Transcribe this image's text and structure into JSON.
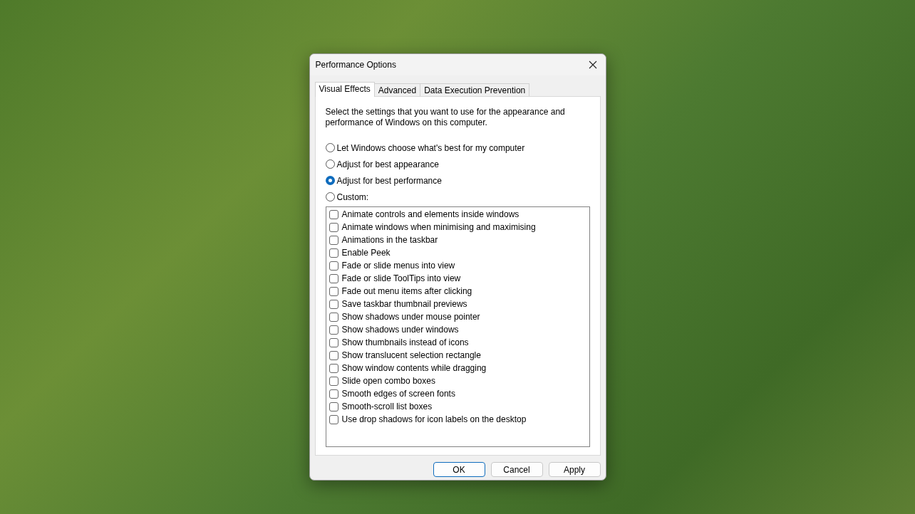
{
  "window": {
    "title": "Performance Options"
  },
  "tabs": [
    {
      "label": "Visual Effects",
      "selected": true
    },
    {
      "label": "Advanced",
      "selected": false
    },
    {
      "label": "Data Execution Prevention",
      "selected": false
    }
  ],
  "description": "Select the settings that you want to use for the appearance and performance of Windows on this computer.",
  "options": [
    {
      "label": "Let Windows choose what's best for my computer",
      "selected": false
    },
    {
      "label": "Adjust for best appearance",
      "selected": false
    },
    {
      "label": "Adjust for best performance",
      "selected": true
    },
    {
      "label": "Custom:",
      "selected": false
    }
  ],
  "effects": [
    {
      "label": "Animate controls and elements inside windows",
      "checked": false
    },
    {
      "label": "Animate windows when minimising and maximising",
      "checked": false
    },
    {
      "label": "Animations in the taskbar",
      "checked": false
    },
    {
      "label": "Enable Peek",
      "checked": false
    },
    {
      "label": "Fade or slide menus into view",
      "checked": false
    },
    {
      "label": "Fade or slide ToolTips into view",
      "checked": false
    },
    {
      "label": "Fade out menu items after clicking",
      "checked": false
    },
    {
      "label": "Save taskbar thumbnail previews",
      "checked": false
    },
    {
      "label": "Show shadows under mouse pointer",
      "checked": false
    },
    {
      "label": "Show shadows under windows",
      "checked": false
    },
    {
      "label": "Show thumbnails instead of icons",
      "checked": false
    },
    {
      "label": "Show translucent selection rectangle",
      "checked": false
    },
    {
      "label": "Show window contents while dragging",
      "checked": false
    },
    {
      "label": "Slide open combo boxes",
      "checked": false
    },
    {
      "label": "Smooth edges of screen fonts",
      "checked": false
    },
    {
      "label": "Smooth-scroll list boxes",
      "checked": false
    },
    {
      "label": "Use drop shadows for icon labels on the desktop",
      "checked": false
    }
  ],
  "buttons": [
    {
      "label": "OK",
      "kind": "default"
    },
    {
      "label": "Cancel",
      "kind": "normal"
    },
    {
      "label": "Apply",
      "kind": "normal"
    }
  ]
}
